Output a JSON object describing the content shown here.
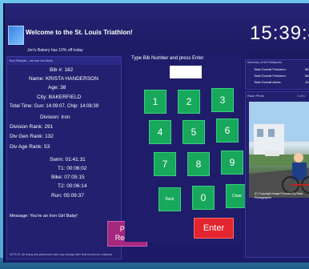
{
  "header": {
    "welcome": "Welcome to the St. Louis Triathlon!",
    "promo": "Jen's Bakery has 10% off today",
    "clock": "15:39:4"
  },
  "results": {
    "header_note": "Your Results - we are not done",
    "bib": "Bib #: 182",
    "name": "Name: KRISTA HANDERSON",
    "age": "Age: 38",
    "city": "City: BAKERFIELD",
    "total_time": "Total Time: Gun: 14:09:07, Chip: 14:08:39",
    "division": "Division: Iron",
    "division_rank": "Division Rank: 291",
    "div_gen_rank": "Div Gen Rank: 132",
    "div_age_rank": "Div Age Rank: 53",
    "swim": "Swim: 01:41:31",
    "t1": "T1: 00:06:02",
    "bike": "Bike: 07:05:15",
    "t2": "T2: 00:06:14",
    "run": "Run: 05:09:37",
    "message": "Message: You're an Iron Girl Baby!",
    "print_label": "Print Receipt"
  },
  "keypad": {
    "title": "Type Bib Number and press Enter",
    "display_value": "",
    "keys": [
      "1",
      "2",
      "3",
      "4",
      "5",
      "6",
      "7",
      "8",
      "9",
      "Back",
      "0",
      "Clear"
    ],
    "enter_label": "Enter"
  },
  "summary": {
    "header": "Summary of All Participants",
    "lines": [
      {
        "label": "Total Overall Finishers:",
        "value": "864"
      },
      {
        "label": "Total Overall Finishers:",
        "value": "682"
      },
      {
        "label": "Total Overall Alerts:",
        "value": "104"
      }
    ]
  },
  "race_photo": {
    "header": "Race Photo",
    "page": "1 of 1",
    "caption": "(C) Copyright Image Provided By Race Photographer"
  },
  "footer": {
    "note": "NOTICE: All timing and placement data may change after final results are released"
  }
}
